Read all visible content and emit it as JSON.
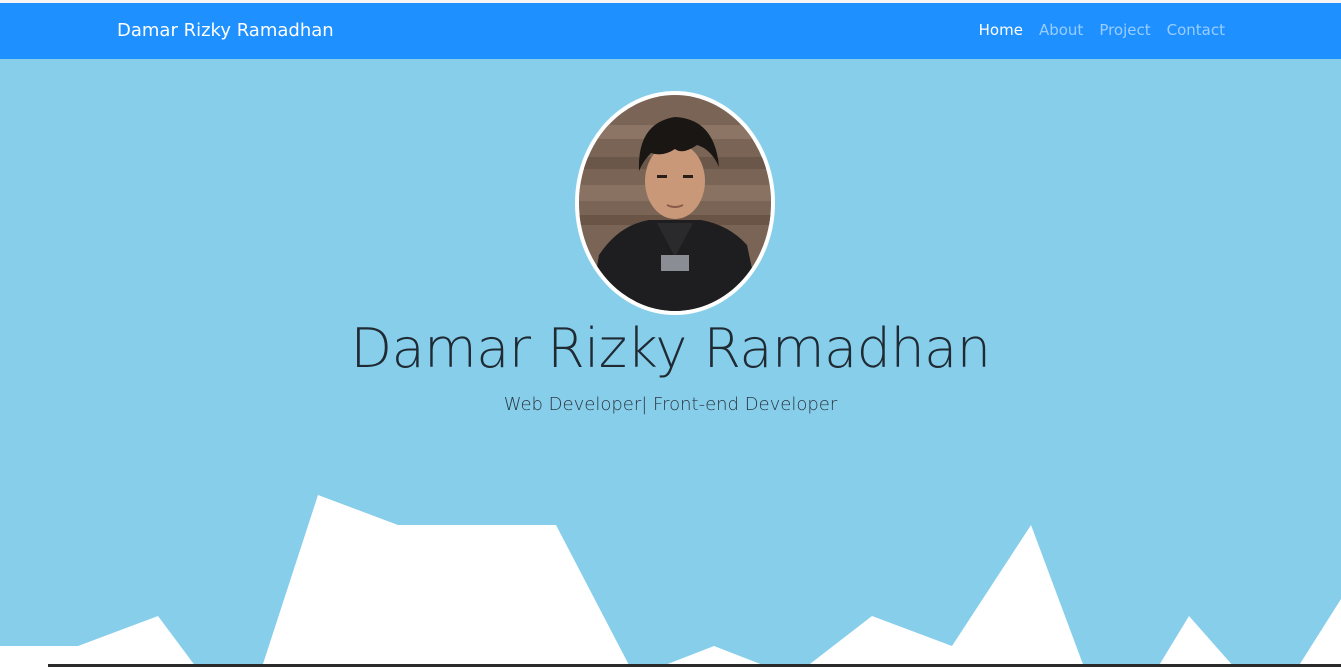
{
  "navbar": {
    "brand": "Damar Rizky Ramadhan",
    "links": [
      {
        "label": "Home",
        "active": true
      },
      {
        "label": "About",
        "active": false
      },
      {
        "label": "Project",
        "active": false
      },
      {
        "label": "Contact",
        "active": false
      }
    ]
  },
  "hero": {
    "name": "Damar Rizky Ramadhan",
    "tagline": "Web Developer| Front-end Developer",
    "avatar_icon": "profile-photo"
  },
  "colors": {
    "navbar_bg": "#1e90ff",
    "hero_bg": "#87ceeb",
    "mountains": "#ffffff"
  }
}
